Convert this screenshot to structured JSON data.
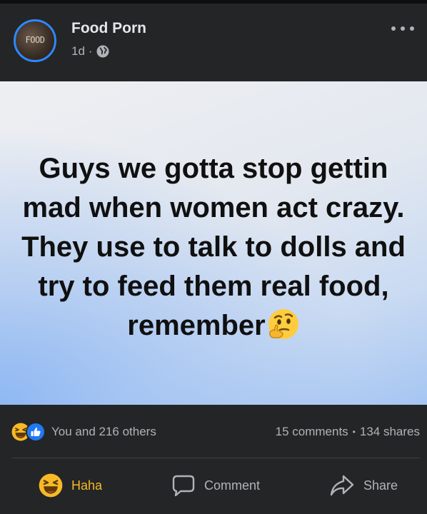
{
  "post": {
    "page_name": "Food Porn",
    "avatar_text": "FOOD",
    "time": "1d",
    "separator": "·",
    "privacy_icon": "globe-icon",
    "more_icon": "more-horizontal-icon",
    "image_text": "Guys we gotta stop gettin mad when women act crazy. They use to talk to dolls and try to feed them real food, remember",
    "image_emoji": "thinking-face-emoji"
  },
  "engagement": {
    "reaction_icons": [
      "haha-reaction-icon",
      "like-reaction-icon"
    ],
    "reactions_text": "You and 216 others",
    "comments_text": "15 comments",
    "stats_separator": "•",
    "shares_text": "134 shares"
  },
  "actions": {
    "haha_label": "Haha",
    "comment_label": "Comment",
    "share_label": "Share"
  },
  "colors": {
    "accent_blue": "#2d88ff",
    "haha_yellow": "#f7b928",
    "background": "#242526",
    "secondary_text": "#b0b3b8"
  }
}
